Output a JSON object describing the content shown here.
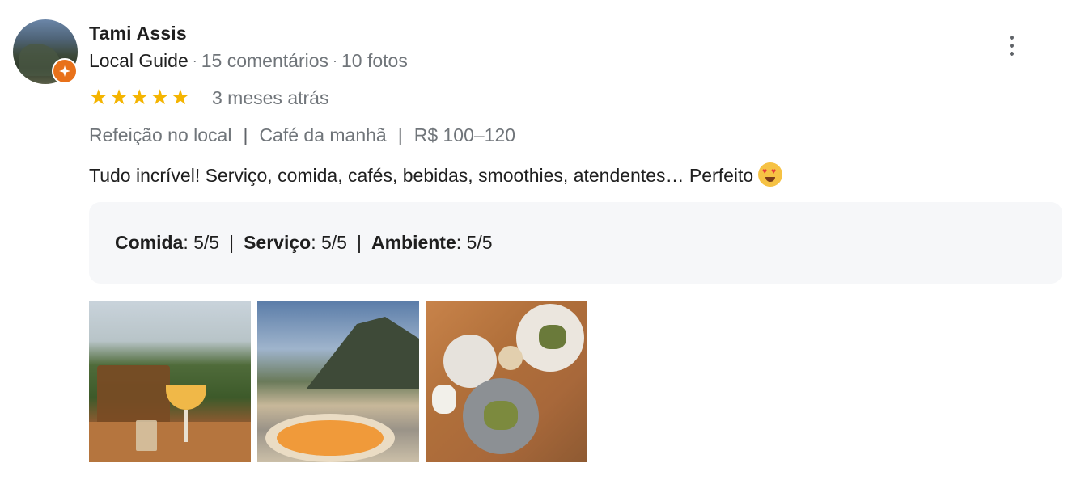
{
  "reviewer": {
    "name": "Tami Assis",
    "level": "Local Guide",
    "reviews_count": "15 comentários",
    "photos_count": "10 fotos"
  },
  "review": {
    "rating": 5,
    "stars": "★★★★★",
    "date": "3 meses atrás",
    "tags": [
      "Refeição no local",
      "Café da manhã",
      "R$ 100–120"
    ],
    "text": "Tudo incrível! Serviço, comida, cafés, bebidas, smoothies, atendentes… Perfeito",
    "emoji": "heart-eyes-emoji"
  },
  "ratings": [
    {
      "label": "Comida",
      "value": ": 5/5"
    },
    {
      "label": "Serviço",
      "value": ": 5/5"
    },
    {
      "label": "Ambiente",
      "value": ": 5/5"
    }
  ],
  "separators": {
    "meta": "·",
    "pipe": "|"
  },
  "photos": [
    {
      "subject": "cocktail-on-table"
    },
    {
      "subject": "beach-dish"
    },
    {
      "subject": "breakfast-table"
    }
  ],
  "colors": {
    "star": "#f4b400",
    "badge": "#e8711a",
    "box": "#f6f7f9"
  }
}
